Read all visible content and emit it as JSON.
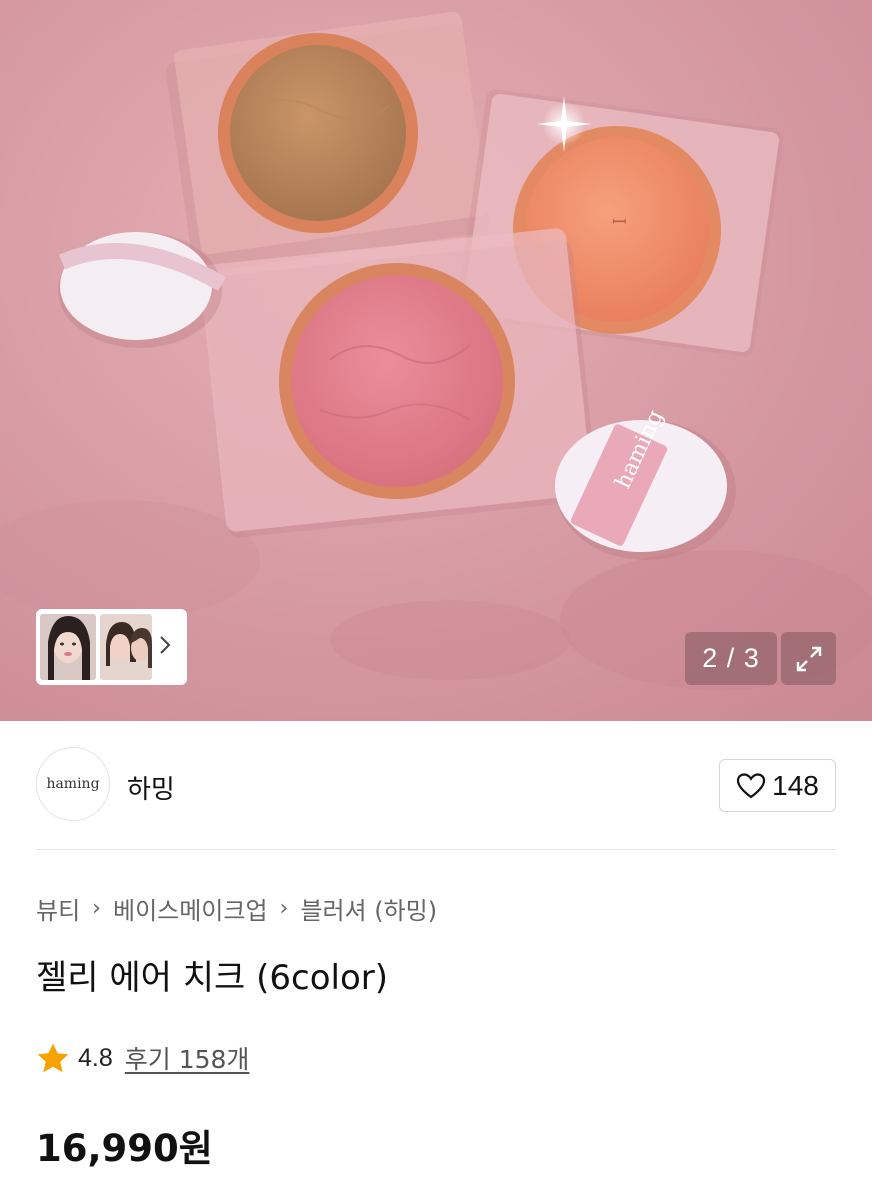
{
  "gallery": {
    "counter": "2 / 3",
    "puff_label": "haming",
    "thumbs_chevron": "›"
  },
  "brand": {
    "logo_text": "haming",
    "name": "하밍",
    "like_count": "148"
  },
  "breadcrumb": {
    "items": [
      "뷰티",
      "베이스메이크업",
      "블러셔 (하밍)"
    ],
    "separator": "›"
  },
  "product": {
    "title": "젤리 에어 치크 (6color)",
    "rating": "4.8",
    "review_label": "후기 158개",
    "price": "16,990원"
  },
  "colors": {
    "star": "#f6a300",
    "background_pink": "#d99da3"
  }
}
